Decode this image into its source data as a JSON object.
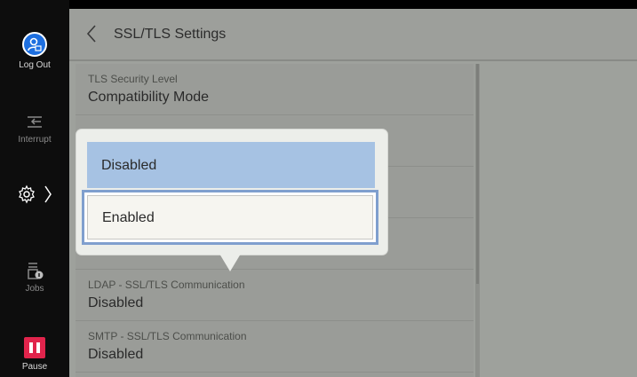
{
  "sidebar": {
    "logout_label": "Log Out",
    "interrupt_label": "Interrupt",
    "jobs_label": "Jobs",
    "pause_label": "Pause"
  },
  "header": {
    "title": "SSL/TLS Settings"
  },
  "settings": [
    {
      "label": "TLS Security Level",
      "value": "Compatibility Mode"
    },
    {
      "label": "",
      "value": ""
    },
    {
      "label": "",
      "value": ""
    },
    {
      "label": "",
      "value": ""
    },
    {
      "label": "LDAP - SSL/TLS Communication",
      "value": "Disabled"
    },
    {
      "label": "SMTP - SSL/TLS Communication",
      "value": "Disabled"
    }
  ],
  "popup": {
    "options": [
      "Disabled",
      "Enabled"
    ],
    "selected": "Enabled"
  },
  "colors": {
    "accent_blue": "#1d6fe0",
    "pause_red": "#e1244c",
    "highlight": "#a6c2e3",
    "selection_border": "#7f9fce"
  },
  "icons": [
    "log-out-icon",
    "interrupt-icon",
    "gear-icon",
    "chevron-right-icon",
    "jobs-icon",
    "pause-icon",
    "back-chevron-icon"
  ]
}
